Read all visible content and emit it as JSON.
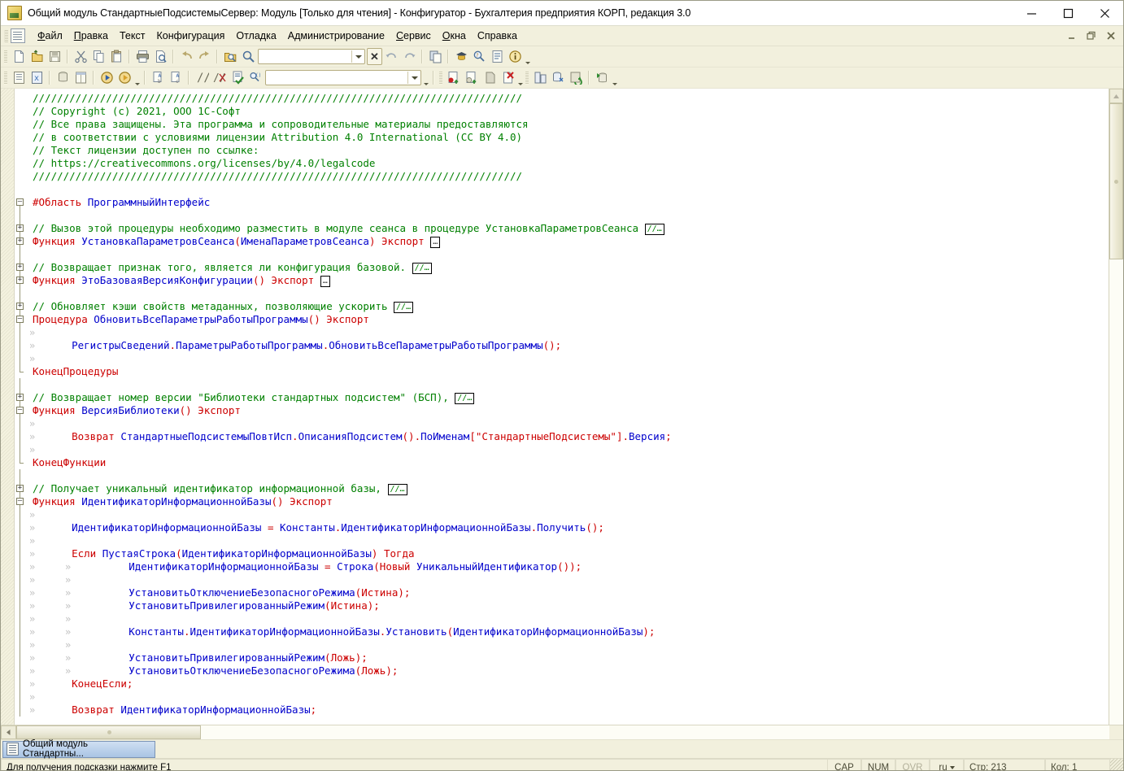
{
  "window": {
    "title": "Общий модуль СтандартныеПодсистемыСервер: Модуль [Только для чтения] - Конфигуратор - Бухгалтерия предприятия КОРП, редакция 3.0",
    "icon": "1c-app-icon",
    "controls": {
      "minimize": "–",
      "maximize": "□",
      "close": "✕"
    }
  },
  "mdi_controls": {
    "minimize": "–",
    "restore": "❐",
    "close": "✕"
  },
  "menubar": {
    "doc_icon": "document-icon",
    "items": [
      {
        "label": "Файл",
        "accel": "Ф"
      },
      {
        "label": "Правка",
        "accel": "П"
      },
      {
        "label": "Текст",
        "accel": ""
      },
      {
        "label": "Конфигурация",
        "accel": ""
      },
      {
        "label": "Отладка",
        "accel": ""
      },
      {
        "label": "Администрирование",
        "accel": ""
      },
      {
        "label": "Сервис",
        "accel": "С"
      },
      {
        "label": "Окна",
        "accel": "О"
      },
      {
        "label": "Справка",
        "accel": ""
      }
    ]
  },
  "toolbar_row1": {
    "search_value": "",
    "buttons": [
      "new-document-icon",
      "open-folder-icon",
      "save-icon",
      "cut-scissors-icon",
      "copy-icon",
      "paste-icon",
      "print-icon",
      "print-preview-icon",
      "undo-arrow-icon",
      "redo-arrow-icon",
      "find-in-files-icon",
      "search-magnifier-icon"
    ],
    "after_combo": [
      "find-previous-icon",
      "find-next-icon",
      "copy-window-icon",
      "syntax-helper-icon",
      "global-search-icon",
      "functions-list-icon",
      "about-info-icon"
    ]
  },
  "toolbar_row2": {
    "search_value": "",
    "buttons": [
      "configuration-tree-icon",
      "configuration-extension-icon",
      "database-config-icon",
      "properties-palette-icon",
      "start-debug-icon",
      "start-debug-client-icon",
      "add-comment-icon",
      "remove-comment-icon",
      "comment-block-icon",
      "uncomment-block-icon",
      "syntax-check-icon",
      "procedures-search-icon"
    ],
    "tail_buttons": [
      "breakpoint-icon",
      "conditional-breakpoint-icon",
      "disable-breakpoints-icon",
      "remove-all-breakpoints-icon",
      "compare-merge-icon",
      "update-db-config-icon",
      "refresh-config-icon",
      "load-config-icon"
    ]
  },
  "editor": {
    "lines": [
      {
        "tokens": [
          {
            "t": "comment",
            "s": "////////////////////////////////////////////////////////////////////////////////"
          }
        ]
      },
      {
        "tokens": [
          {
            "t": "comment",
            "s": "// Copyright (c) 2021, ООО 1С-Софт"
          }
        ]
      },
      {
        "tokens": [
          {
            "t": "comment",
            "s": "// Все права защищены. Эта программа и сопроводительные материалы предоставляются"
          }
        ]
      },
      {
        "tokens": [
          {
            "t": "comment",
            "s": "// в соответствии с условиями лицензии Attribution 4.0 International (CC BY 4.0)"
          }
        ]
      },
      {
        "tokens": [
          {
            "t": "comment",
            "s": "// Текст лицензии доступен по ссылке:"
          }
        ]
      },
      {
        "tokens": [
          {
            "t": "comment",
            "s": "// https://creativecommons.org/licenses/by/4.0/legalcode"
          }
        ]
      },
      {
        "tokens": [
          {
            "t": "comment",
            "s": "////////////////////////////////////////////////////////////////////////////////"
          }
        ]
      },
      {
        "tokens": []
      },
      {
        "fold": "minus",
        "vline": "start",
        "tokens": [
          {
            "t": "key",
            "s": "#Область"
          },
          {
            "t": "plain",
            "s": " "
          },
          {
            "t": "ident",
            "s": "ПрограммныйИнтерфейс"
          }
        ]
      },
      {
        "vline": "mid",
        "tokens": []
      },
      {
        "fold": "plus",
        "vline": "mid",
        "tokens": [
          {
            "t": "comment",
            "s": "// Вызов этой процедуры необходимо разместить в модуле сеанса в процедуре УстановкаПараметровСеанса"
          },
          {
            "t": "boxcom",
            "s": "//…"
          }
        ]
      },
      {
        "fold": "plus",
        "vline": "mid",
        "tokens": [
          {
            "t": "key",
            "s": "Функция"
          },
          {
            "t": "plain",
            "s": " "
          },
          {
            "t": "ident",
            "s": "УстановкаПараметровСеанса"
          },
          {
            "t": "op",
            "s": "("
          },
          {
            "t": "ident",
            "s": "ИменаПараметровСеанса"
          },
          {
            "t": "op",
            "s": ")"
          },
          {
            "t": "plain",
            "s": " "
          },
          {
            "t": "key",
            "s": "Экспорт"
          },
          {
            "t": "box",
            "s": "…"
          }
        ]
      },
      {
        "vline": "mid",
        "tokens": []
      },
      {
        "fold": "plus",
        "vline": "mid",
        "tokens": [
          {
            "t": "comment",
            "s": "// Возвращает признак того, является ли конфигурация базовой."
          },
          {
            "t": "boxcom",
            "s": "//…"
          }
        ]
      },
      {
        "fold": "plus",
        "vline": "mid",
        "tokens": [
          {
            "t": "key",
            "s": "Функция"
          },
          {
            "t": "plain",
            "s": " "
          },
          {
            "t": "ident",
            "s": "ЭтоБазоваяВерсияКонфигурации"
          },
          {
            "t": "op",
            "s": "()"
          },
          {
            "t": "plain",
            "s": " "
          },
          {
            "t": "key",
            "s": "Экспорт"
          },
          {
            "t": "box",
            "s": "…"
          }
        ]
      },
      {
        "vline": "mid",
        "tokens": []
      },
      {
        "fold": "plus",
        "vline": "mid",
        "tokens": [
          {
            "t": "comment",
            "s": "// Обновляет кэши свойств метаданных, позволяющие ускорить"
          },
          {
            "t": "boxcom",
            "s": "//…"
          }
        ]
      },
      {
        "fold": "minus",
        "vline": "mid",
        "tokens": [
          {
            "t": "key",
            "s": "Процедура"
          },
          {
            "t": "plain",
            "s": " "
          },
          {
            "t": "ident",
            "s": "ОбновитьВсеПараметрыРаботыПрограммы"
          },
          {
            "t": "op",
            "s": "()"
          },
          {
            "t": "plain",
            "s": " "
          },
          {
            "t": "key",
            "s": "Экспорт"
          }
        ]
      },
      {
        "vline": "mid",
        "cont": 1,
        "tokens": []
      },
      {
        "vline": "mid",
        "cont": 1,
        "tokens": [
          {
            "t": "plain",
            "s": "    "
          },
          {
            "t": "ident",
            "s": "РегистрыСведений"
          },
          {
            "t": "op",
            "s": "."
          },
          {
            "t": "ident",
            "s": "ПараметрыРаботыПрограммы"
          },
          {
            "t": "op",
            "s": "."
          },
          {
            "t": "ident",
            "s": "ОбновитьВсеПараметрыРаботыПрограммы"
          },
          {
            "t": "op",
            "s": "();"
          }
        ]
      },
      {
        "vline": "mid",
        "cont": 1,
        "tokens": []
      },
      {
        "foldend": true,
        "tokens": [
          {
            "t": "key",
            "s": "КонецПроцедуры"
          }
        ]
      },
      {
        "vline": "mid",
        "tokens": []
      },
      {
        "fold": "plus",
        "vline": "mid",
        "tokens": [
          {
            "t": "comment",
            "s": "// Возвращает номер версии \"Библиотеки стандартных подсистем\" (БСП),"
          },
          {
            "t": "boxcom",
            "s": "//…"
          }
        ]
      },
      {
        "fold": "minus",
        "vline": "mid",
        "tokens": [
          {
            "t": "key",
            "s": "Функция"
          },
          {
            "t": "plain",
            "s": " "
          },
          {
            "t": "ident",
            "s": "ВерсияБиблиотеки"
          },
          {
            "t": "op",
            "s": "()"
          },
          {
            "t": "plain",
            "s": " "
          },
          {
            "t": "key",
            "s": "Экспорт"
          }
        ]
      },
      {
        "vline": "mid",
        "cont": 1,
        "tokens": []
      },
      {
        "vline": "mid",
        "cont": 1,
        "tokens": [
          {
            "t": "plain",
            "s": "    "
          },
          {
            "t": "key",
            "s": "Возврат"
          },
          {
            "t": "plain",
            "s": " "
          },
          {
            "t": "ident",
            "s": "СтандартныеПодсистемыПовтИсп"
          },
          {
            "t": "op",
            "s": "."
          },
          {
            "t": "ident",
            "s": "ОписанияПодсистем"
          },
          {
            "t": "op",
            "s": "()."
          },
          {
            "t": "ident",
            "s": "ПоИменам"
          },
          {
            "t": "op",
            "s": "["
          },
          {
            "t": "str",
            "s": "\"СтандартныеПодсистемы\""
          },
          {
            "t": "op",
            "s": "]."
          },
          {
            "t": "ident",
            "s": "Версия"
          },
          {
            "t": "op",
            "s": ";"
          }
        ]
      },
      {
        "vline": "mid",
        "cont": 1,
        "tokens": []
      },
      {
        "foldend": true,
        "tokens": [
          {
            "t": "key",
            "s": "КонецФункции"
          }
        ]
      },
      {
        "vline": "mid",
        "tokens": []
      },
      {
        "fold": "plus",
        "vline": "mid",
        "tokens": [
          {
            "t": "comment",
            "s": "// Получает уникальный идентификатор информационной базы,"
          },
          {
            "t": "boxcom",
            "s": "//…"
          }
        ]
      },
      {
        "fold": "minus",
        "vline": "mid",
        "tokens": [
          {
            "t": "key",
            "s": "Функция"
          },
          {
            "t": "plain",
            "s": " "
          },
          {
            "t": "ident",
            "s": "ИдентификаторИнформационнойБазы"
          },
          {
            "t": "op",
            "s": "()"
          },
          {
            "t": "plain",
            "s": " "
          },
          {
            "t": "key",
            "s": "Экспорт"
          }
        ]
      },
      {
        "vline": "mid",
        "cont": 1,
        "tokens": []
      },
      {
        "vline": "mid",
        "cont": 1,
        "tokens": [
          {
            "t": "plain",
            "s": "    "
          },
          {
            "t": "ident",
            "s": "ИдентификаторИнформационнойБазы"
          },
          {
            "t": "plain",
            "s": " "
          },
          {
            "t": "op",
            "s": "="
          },
          {
            "t": "plain",
            "s": " "
          },
          {
            "t": "ident",
            "s": "Константы"
          },
          {
            "t": "op",
            "s": "."
          },
          {
            "t": "ident",
            "s": "ИдентификаторИнформационнойБазы"
          },
          {
            "t": "op",
            "s": "."
          },
          {
            "t": "ident",
            "s": "Получить"
          },
          {
            "t": "op",
            "s": "();"
          }
        ]
      },
      {
        "vline": "mid",
        "cont": 1,
        "tokens": []
      },
      {
        "vline": "mid",
        "cont": 1,
        "tokens": [
          {
            "t": "plain",
            "s": "    "
          },
          {
            "t": "key",
            "s": "Если"
          },
          {
            "t": "plain",
            "s": " "
          },
          {
            "t": "ident",
            "s": "ПустаяСтрока"
          },
          {
            "t": "op",
            "s": "("
          },
          {
            "t": "ident",
            "s": "ИдентификаторИнформационнойБазы"
          },
          {
            "t": "op",
            "s": ")"
          },
          {
            "t": "plain",
            "s": " "
          },
          {
            "t": "key",
            "s": "Тогда"
          }
        ]
      },
      {
        "vline": "mid",
        "cont": 2,
        "tokens": [
          {
            "t": "plain",
            "s": "        "
          },
          {
            "t": "ident",
            "s": "ИдентификаторИнформационнойБазы"
          },
          {
            "t": "plain",
            "s": " "
          },
          {
            "t": "op",
            "s": "="
          },
          {
            "t": "plain",
            "s": " "
          },
          {
            "t": "ident",
            "s": "Строка"
          },
          {
            "t": "op",
            "s": "("
          },
          {
            "t": "key",
            "s": "Новый"
          },
          {
            "t": "plain",
            "s": " "
          },
          {
            "t": "ident",
            "s": "УникальныйИдентификатор"
          },
          {
            "t": "op",
            "s": "());"
          }
        ]
      },
      {
        "vline": "mid",
        "cont": 2,
        "tokens": []
      },
      {
        "vline": "mid",
        "cont": 2,
        "tokens": [
          {
            "t": "plain",
            "s": "        "
          },
          {
            "t": "ident",
            "s": "УстановитьОтключениеБезопасногоРежима"
          },
          {
            "t": "op",
            "s": "("
          },
          {
            "t": "key",
            "s": "Истина"
          },
          {
            "t": "op",
            "s": ");"
          }
        ]
      },
      {
        "vline": "mid",
        "cont": 2,
        "tokens": [
          {
            "t": "plain",
            "s": "        "
          },
          {
            "t": "ident",
            "s": "УстановитьПривилегированныйРежим"
          },
          {
            "t": "op",
            "s": "("
          },
          {
            "t": "key",
            "s": "Истина"
          },
          {
            "t": "op",
            "s": ");"
          }
        ]
      },
      {
        "vline": "mid",
        "cont": 2,
        "tokens": []
      },
      {
        "vline": "mid",
        "cont": 2,
        "tokens": [
          {
            "t": "plain",
            "s": "        "
          },
          {
            "t": "ident",
            "s": "Константы"
          },
          {
            "t": "op",
            "s": "."
          },
          {
            "t": "ident",
            "s": "ИдентификаторИнформационнойБазы"
          },
          {
            "t": "op",
            "s": "."
          },
          {
            "t": "ident",
            "s": "Установить"
          },
          {
            "t": "op",
            "s": "("
          },
          {
            "t": "ident",
            "s": "ИдентификаторИнформационнойБазы"
          },
          {
            "t": "op",
            "s": ");"
          }
        ]
      },
      {
        "vline": "mid",
        "cont": 2,
        "tokens": []
      },
      {
        "vline": "mid",
        "cont": 2,
        "tokens": [
          {
            "t": "plain",
            "s": "        "
          },
          {
            "t": "ident",
            "s": "УстановитьПривилегированныйРежим"
          },
          {
            "t": "op",
            "s": "("
          },
          {
            "t": "key",
            "s": "Ложь"
          },
          {
            "t": "op",
            "s": ");"
          }
        ]
      },
      {
        "vline": "mid",
        "cont": 2,
        "tokens": [
          {
            "t": "plain",
            "s": "        "
          },
          {
            "t": "ident",
            "s": "УстановитьОтключениеБезопасногоРежима"
          },
          {
            "t": "op",
            "s": "("
          },
          {
            "t": "key",
            "s": "Ложь"
          },
          {
            "t": "op",
            "s": ");"
          }
        ]
      },
      {
        "vline": "mid",
        "cont": 1,
        "tokens": [
          {
            "t": "plain",
            "s": "    "
          },
          {
            "t": "key",
            "s": "КонецЕсли"
          },
          {
            "t": "op",
            "s": ";"
          }
        ]
      },
      {
        "vline": "mid",
        "cont": 1,
        "tokens": []
      },
      {
        "vline": "mid",
        "cont": 1,
        "tokens": [
          {
            "t": "plain",
            "s": "    "
          },
          {
            "t": "key",
            "s": "Возврат"
          },
          {
            "t": "plain",
            "s": " "
          },
          {
            "t": "ident",
            "s": "ИдентификаторИнформационнойБазы"
          },
          {
            "t": "op",
            "s": ";"
          }
        ]
      }
    ]
  },
  "mdi_tabs": [
    {
      "label": "Общий модуль Стандартны...",
      "icon": "module-document-icon",
      "active": true
    }
  ],
  "statusbar": {
    "hint": "Для получения подсказки нажмите F1",
    "cap": "CAP",
    "num": "NUM",
    "ovr": "OVR",
    "lang": "ru",
    "line": "Стр: 213",
    "column": "Кол: 1"
  },
  "colors": {
    "comment": "#008000",
    "keyword": "#cc0000",
    "identifier": "#0000cc",
    "string": "#cc0000",
    "chrome": "#f2f0dd",
    "tab_active": "#a9c4e4"
  }
}
